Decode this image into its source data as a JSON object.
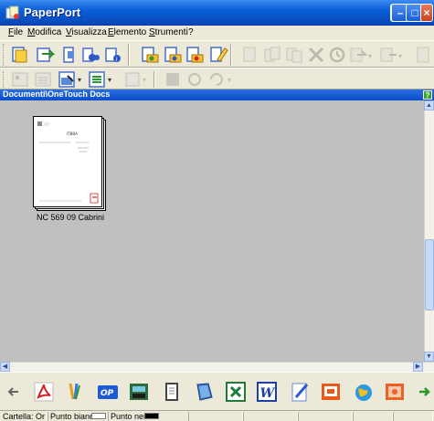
{
  "window": {
    "title": "PaperPort"
  },
  "menu": [
    "File",
    "Modifica",
    "Visualizza",
    "Elemento",
    "Strumenti",
    "?"
  ],
  "folder": {
    "path": "Documenti\\OneTouch Docs",
    "help": "?"
  },
  "document": {
    "label": "NC 569 09 Cabrini",
    "heading": "ITBBA"
  },
  "status": {
    "cartella": "Cartella: Or",
    "punto_bianco": "Punto bianco:",
    "punto_nero": "Punto nero:"
  },
  "colors": {
    "title_blue": "#0a5fd8",
    "desktop_gray": "#c0c0c0",
    "pdf_red": "#d42020",
    "excel_green": "#1e7b3a",
    "word_blue": "#1c3fa8"
  },
  "toolbar_icons": [
    "scan-icon",
    "acquire-icon",
    "page-view-icon",
    "binoculars-icon",
    "properties-icon",
    "new-folder-icon",
    "add-folder-icon",
    "folder-icon",
    "highlight-icon",
    "stack-icon",
    "unstack-icon",
    "copy-icon",
    "delete-icon",
    "rotate-icon",
    "send-to-icon",
    "move-icon",
    "page-icon"
  ],
  "sendto_icons": [
    "back-arrow-icon",
    "pdf-icon",
    "paint-icon",
    "op-icon",
    "fax-icon",
    "notepad-icon",
    "blank-page-icon",
    "excel-icon",
    "word-icon",
    "pencil-note-icon",
    "slideshow-icon",
    "globe-icon",
    "photo-icon",
    "forward-arrow-icon"
  ]
}
